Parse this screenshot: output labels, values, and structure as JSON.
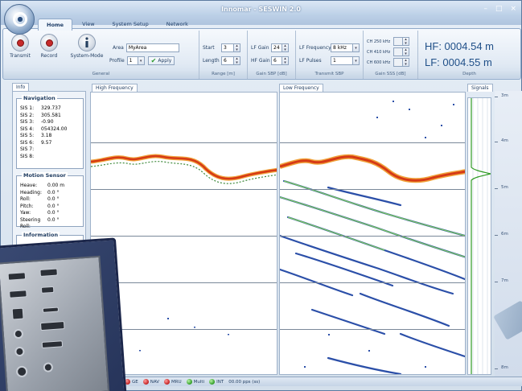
{
  "window": {
    "title": "Innomar - SESWIN 2.0",
    "controls": [
      "–",
      "□",
      "×"
    ]
  },
  "tabs": [
    "Home",
    "View",
    "System Setup",
    "Network"
  ],
  "ribbon": {
    "general": {
      "label": "General",
      "transmit": "Transmit",
      "record": "Record",
      "system_mode": "System-Mode",
      "area_label": "Area",
      "area_value": "MyArea",
      "profile_label": "Profile",
      "profile_value": "1",
      "apply": "Apply"
    },
    "range": {
      "label": "Range [m]",
      "start_label": "Start",
      "start_value": "3",
      "length_label": "Length",
      "length_value": "6"
    },
    "gain_sbp": {
      "label": "Gain SBP [dB]",
      "lf_gain_label": "LF Gain",
      "lf_gain_value": "24",
      "hf_gain_label": "HF Gain",
      "hf_gain_value": "6"
    },
    "transmit_sbp": {
      "label": "Transmit SBP",
      "lf_freq_label": "LF Frequency",
      "lf_freq_value": "8 kHz",
      "lf_pulses_label": "LF Pulses",
      "lf_pulses_value": "1"
    },
    "gain_sss": {
      "label": "Gain SSS [dB]",
      "ch1": "CH 250 kHz",
      "ch2": "CH 410 kHz",
      "ch3": "CH 600 kHz"
    },
    "depth": {
      "label": "Depth",
      "hf": "HF: 0004.54 m",
      "lf": "LF: 0004.55 m"
    }
  },
  "panels": {
    "info": "Info",
    "high_frequency": "High Frequency",
    "low_frequency": "Low Frequency",
    "signals": "Signals"
  },
  "navigation": {
    "title": "Navigation",
    "rows": [
      {
        "k": "SIS 1:",
        "v": "329.737"
      },
      {
        "k": "SIS 2:",
        "v": "305.581"
      },
      {
        "k": "SIS 3:",
        "v": "-0.90"
      },
      {
        "k": "SIS 4:",
        "v": "054324.00"
      },
      {
        "k": "SIS 5:",
        "v": "3.18"
      },
      {
        "k": "SIS 6:",
        "v": "9.57"
      },
      {
        "k": "SIS 7:",
        "v": ""
      },
      {
        "k": "SIS 8:",
        "v": ""
      }
    ]
  },
  "motion": {
    "title": "Motion Sensor",
    "rows": [
      {
        "k": "Heave:",
        "v": "0.00 m"
      },
      {
        "k": "Heading:",
        "v": "0.0 °"
      },
      {
        "k": "Roll:",
        "v": "0.0 °"
      },
      {
        "k": "Pitch:",
        "v": "0.0 °"
      },
      {
        "k": "Yaw:",
        "v": "0.0 °"
      },
      {
        "k": "Steering Roll:",
        "v": "0.0 °"
      }
    ]
  },
  "information": {
    "title": "Information"
  },
  "depth_scale": [
    "3m",
    "4m",
    "5m",
    "6m",
    "7m",
    "8m"
  ],
  "status": {
    "items": [
      {
        "label": "GE",
        "color": "red"
      },
      {
        "label": "NAV",
        "color": "red"
      },
      {
        "label": "MRU",
        "color": "red"
      },
      {
        "label": "Multi",
        "color": "green"
      },
      {
        "label": "INT",
        "color": "green"
      }
    ],
    "ppu": "00.00 pps (ss)"
  },
  "colors": {
    "accent": "#1f4f88",
    "bottom_echo": "#e2541c",
    "sediment": "#2b4fa8"
  }
}
